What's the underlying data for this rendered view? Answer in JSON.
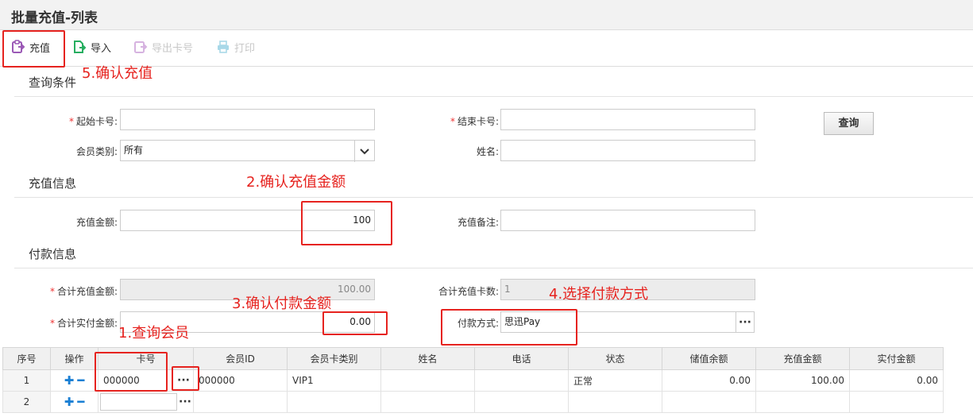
{
  "page": {
    "title": "批量充值-列表"
  },
  "toolbar": {
    "recharge": "充值",
    "import": "导入",
    "export_card": "导出卡号",
    "print": "打印"
  },
  "query": {
    "section_title": "查询条件",
    "start_card_label": "起始卡号:",
    "start_card_value": "",
    "end_card_label": "结束卡号:",
    "end_card_value": "",
    "member_type_label": "会员类别:",
    "member_type_value": "所有",
    "name_label": "姓名:",
    "name_value": "",
    "query_button": "查询"
  },
  "recharge_info": {
    "section_title": "充值信息",
    "amount_label": "充值金额:",
    "amount_value": "100",
    "note_label": "充值备注:",
    "note_value": ""
  },
  "payment_info": {
    "section_title": "付款信息",
    "total_recharge_label": "合计充值金额:",
    "total_recharge_value": "100.00",
    "total_cards_label": "合计充值卡数:",
    "total_cards_value": "1",
    "total_paid_label": "合计实付金额:",
    "total_paid_value": "0.00",
    "pay_method_label": "付款方式:",
    "pay_method_value": "思迅Pay"
  },
  "annotations": {
    "step1": "1.查询会员",
    "step2": "2.确认充值金额",
    "step3": "3.确认付款金额",
    "step4": "4.选择付款方式",
    "step5": "5.确认充值"
  },
  "grid": {
    "headers": [
      "序号",
      "操作",
      "卡号",
      "会员ID",
      "会员卡类别",
      "姓名",
      "电话",
      "状态",
      "储值余额",
      "充值金额",
      "实付金额"
    ],
    "rows": [
      {
        "idx": "1",
        "card": "000000",
        "member_id": "000000",
        "card_type": "VIP1",
        "name": "",
        "phone": "",
        "status": "正常",
        "balance": "0.00",
        "recharge": "100.00",
        "paid": "0.00"
      },
      {
        "idx": "2",
        "card": "",
        "member_id": "",
        "card_type": "",
        "name": "",
        "phone": "",
        "status": "",
        "balance": "",
        "recharge": "",
        "paid": ""
      }
    ]
  },
  "colors": {
    "accent": "#e6231f",
    "recharge_icon": "#9b59b6",
    "import_icon": "#27ae60",
    "disabled": "#c8c8c8"
  }
}
